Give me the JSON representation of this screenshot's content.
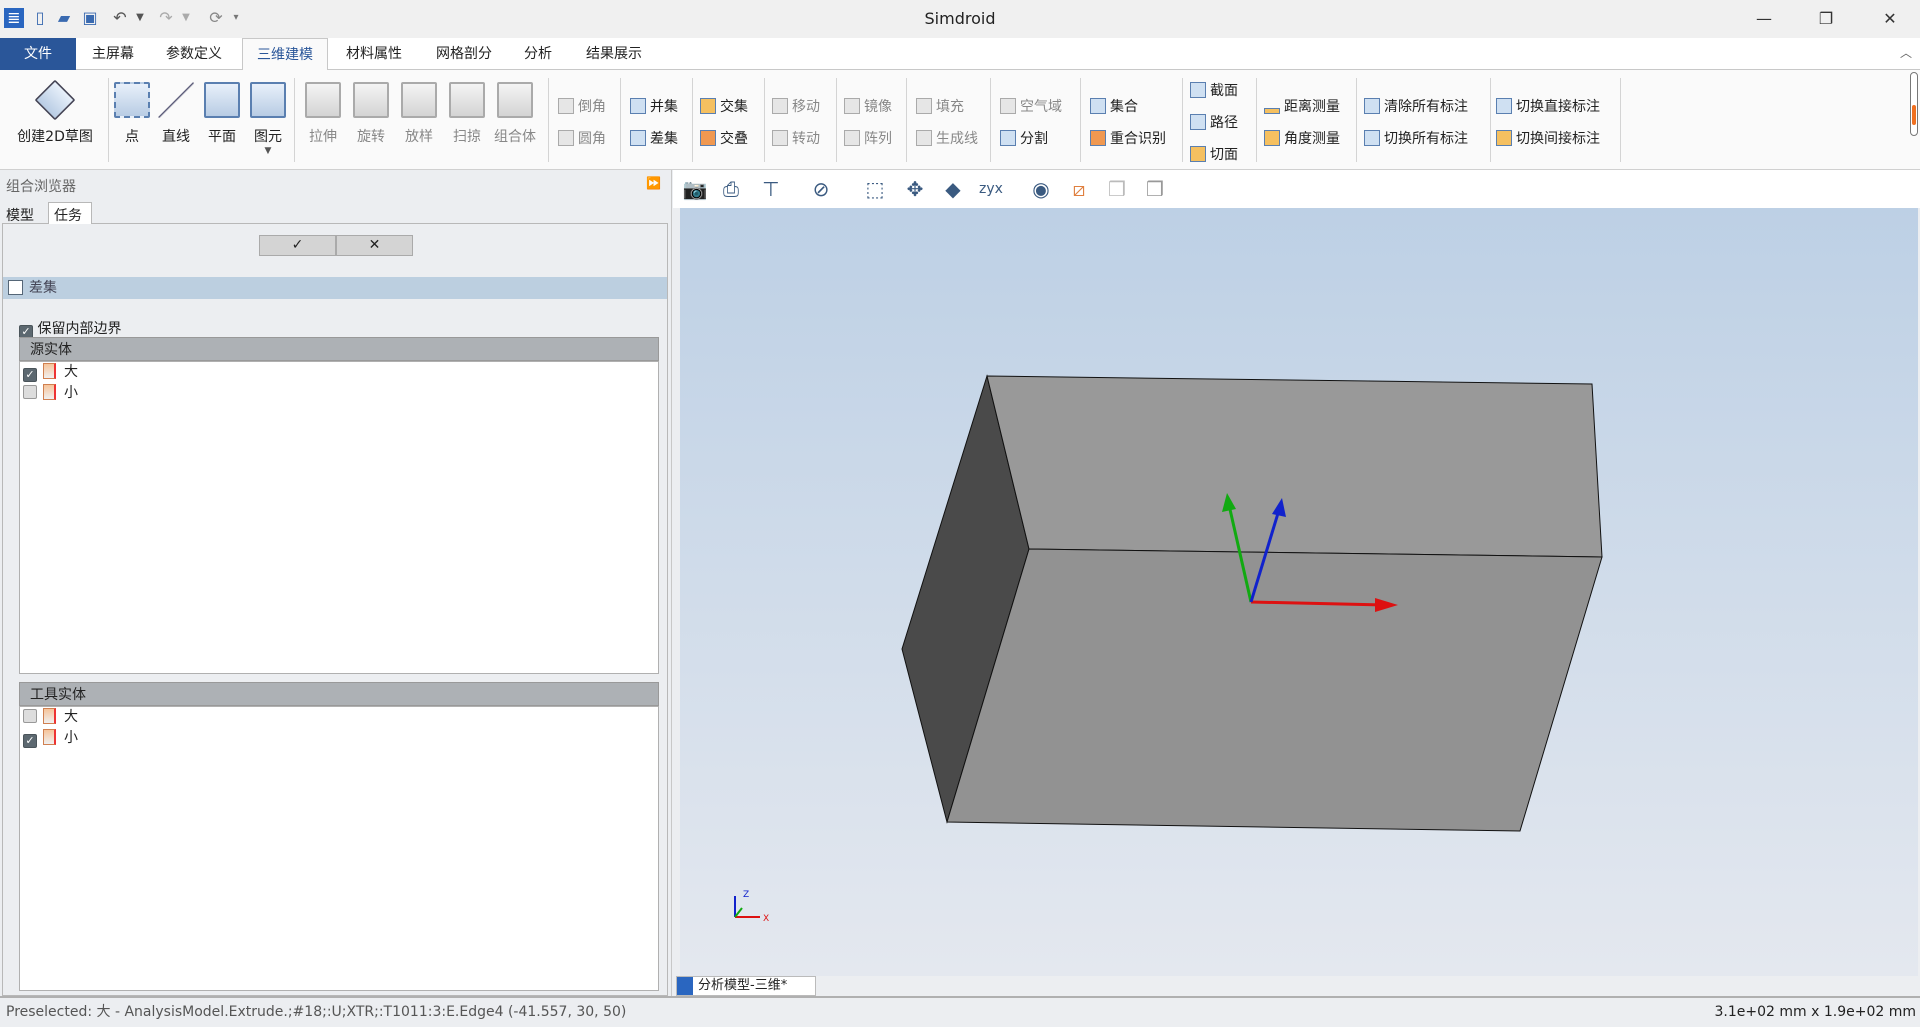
{
  "app": {
    "title": "Simdroid"
  },
  "quick_access": [
    "app-logo",
    "new",
    "open",
    "save",
    "undo",
    "redo",
    "refresh",
    "customize"
  ],
  "window_controls": {
    "minimize": "—",
    "restore": "❐",
    "close": "✕"
  },
  "tabs": [
    {
      "label": "文件"
    },
    {
      "label": "主屏幕"
    },
    {
      "label": "参数定义"
    },
    {
      "label": "三维建模",
      "active": true
    },
    {
      "label": "材料属性"
    },
    {
      "label": "网格剖分"
    },
    {
      "label": "分析"
    },
    {
      "label": "结果展示"
    }
  ],
  "ribbon": {
    "large": [
      {
        "label": "创建2D草图"
      },
      {
        "label": "点"
      },
      {
        "label": "直线"
      },
      {
        "label": "平面"
      },
      {
        "label": "图元"
      },
      {
        "label": "拉伸"
      },
      {
        "label": "旋转"
      },
      {
        "label": "放样"
      },
      {
        "label": "扫掠"
      },
      {
        "label": "组合体"
      }
    ],
    "small": [
      {
        "label": "倒角"
      },
      {
        "label": "圆角"
      },
      {
        "label": "并集"
      },
      {
        "label": "差集"
      },
      {
        "label": "交集"
      },
      {
        "label": "交叠"
      },
      {
        "label": "移动"
      },
      {
        "label": "转动"
      },
      {
        "label": "镜像"
      },
      {
        "label": "阵列"
      },
      {
        "label": "填充"
      },
      {
        "label": "生成线"
      },
      {
        "label": "空气域"
      },
      {
        "label": "分割"
      },
      {
        "label": "集合"
      },
      {
        "label": "重合识别"
      },
      {
        "label": "截面"
      },
      {
        "label": "路径"
      },
      {
        "label": "切面"
      },
      {
        "label": "距离测量"
      },
      {
        "label": "角度测量"
      },
      {
        "label": "清除所有标注"
      },
      {
        "label": "切换所有标注"
      },
      {
        "label": "切换直接标注"
      },
      {
        "label": "切换间接标注"
      }
    ]
  },
  "left_panel": {
    "title": "组合浏览器",
    "tabs": [
      {
        "label": "模型"
      },
      {
        "label": "任务",
        "active": true
      }
    ],
    "ok": "✓",
    "cancel": "✕",
    "task_title": "差集",
    "keep_internal": {
      "label": "保留内部边界",
      "checked": true
    },
    "source": {
      "header": "源实体",
      "items": [
        {
          "label": "大",
          "checked": true
        },
        {
          "label": "小",
          "checked": false
        }
      ]
    },
    "tool": {
      "header": "工具实体",
      "items": [
        {
          "label": "大",
          "checked": false
        },
        {
          "label": "小",
          "checked": true
        }
      ]
    }
  },
  "view_toolbar": [
    "camera",
    "print",
    "sketch-plane",
    "no-render",
    "zoom-box",
    "fit-all",
    "view-iso",
    "axis-view",
    "visibility",
    "section",
    "light-1",
    "light-2"
  ],
  "viewport": {
    "axes": {
      "x": "X",
      "y": "Y",
      "z": "Z"
    },
    "colors": {
      "top": "#999999",
      "front": "#929292",
      "left": "#4a4a4a",
      "x": "#dd1111",
      "y": "#11aa11",
      "z": "#1122cc"
    }
  },
  "doc_tab": {
    "label": "分析模型-三维*"
  },
  "status": {
    "left": "Preselected: 大 - AnalysisModel.Extrude.;#18;:U;XTR;:T1011:3:E.Edge4 (-41.557, 30, 50)",
    "right": "3.1e+02 mm x 1.9e+02 mm"
  }
}
